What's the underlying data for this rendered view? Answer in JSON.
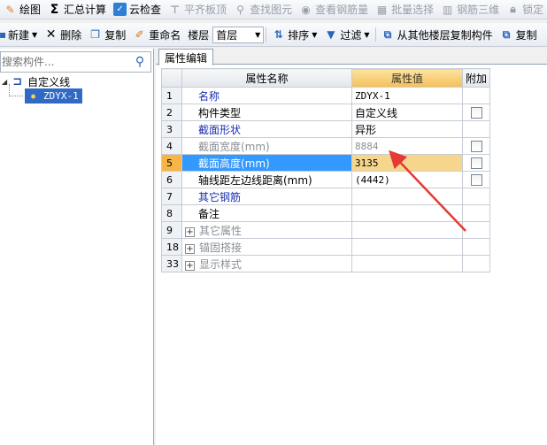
{
  "toolbar1": {
    "items": [
      {
        "label": "绘图",
        "icon": "pencil-icon",
        "disabled": false
      },
      {
        "label": "汇总计算",
        "icon": "sigma-icon",
        "disabled": false
      },
      {
        "label": "云检查",
        "icon": "cloud-check-icon",
        "disabled": false
      },
      {
        "label": "平齐板顶",
        "icon": "align-top-icon",
        "disabled": true
      },
      {
        "label": "查找图元",
        "icon": "binoculars-icon",
        "disabled": true
      },
      {
        "label": "查看钢筋量",
        "icon": "eye-icon",
        "disabled": true
      },
      {
        "label": "批量选择",
        "icon": "grid-select-icon",
        "disabled": true
      },
      {
        "label": "钢筋三维",
        "icon": "cube-icon",
        "disabled": true
      },
      {
        "label": "锁定",
        "icon": "lock-icon",
        "disabled": true
      }
    ]
  },
  "toolbar2": {
    "new_label": "新建",
    "delete_label": "删除",
    "copy_label": "复制",
    "rename_label": "重命名",
    "layer_label": "楼层",
    "layer_value": "首层",
    "sort_label": "排序",
    "filter_label": "过滤",
    "copy_from_layer_label": "从其他楼层复制构件",
    "copy_short_label": "复制"
  },
  "left_panel": {
    "search_placeholder": "搜索构件...",
    "tree_root": "自定义线",
    "tree_child": "ZDYX-1"
  },
  "right_panel": {
    "tab": "属性编辑",
    "headers": {
      "name": "属性名称",
      "value": "属性值",
      "extra": "附加"
    },
    "rows": [
      {
        "num": "1",
        "name": "名称",
        "value": "ZDYX-1",
        "style": "blue",
        "checkbox": false,
        "expand": false
      },
      {
        "num": "2",
        "name": "构件类型",
        "value": "自定义线",
        "style": "normal",
        "checkbox": true,
        "expand": false
      },
      {
        "num": "3",
        "name": "截面形状",
        "value": "异形",
        "style": "blue",
        "checkbox": false,
        "expand": false
      },
      {
        "num": "4",
        "name": "截面宽度(mm)",
        "value": "8884",
        "style": "grey",
        "checkbox": true,
        "expand": false
      },
      {
        "num": "5",
        "name": "截面高度(mm)",
        "value": "3135",
        "style": "selected",
        "checkbox": true,
        "expand": false
      },
      {
        "num": "6",
        "name": "轴线距左边线距离(mm)",
        "value": "(4442)",
        "style": "normal",
        "checkbox": true,
        "expand": false
      },
      {
        "num": "7",
        "name": "其它钢筋",
        "value": "",
        "style": "blue",
        "checkbox": false,
        "expand": false
      },
      {
        "num": "8",
        "name": "备注",
        "value": "",
        "style": "normal",
        "checkbox": false,
        "expand": false
      },
      {
        "num": "9",
        "name": "其它属性",
        "value": "",
        "style": "grey",
        "checkbox": false,
        "expand": true
      },
      {
        "num": "18",
        "name": "锚固搭接",
        "value": "",
        "style": "grey",
        "checkbox": false,
        "expand": true
      },
      {
        "num": "33",
        "name": "显示样式",
        "value": "",
        "style": "grey",
        "checkbox": false,
        "expand": true
      }
    ]
  },
  "colors": {
    "annotation_arrow": "#e53935",
    "selection": "#3399ff",
    "value_header": "#f4bf5a"
  }
}
